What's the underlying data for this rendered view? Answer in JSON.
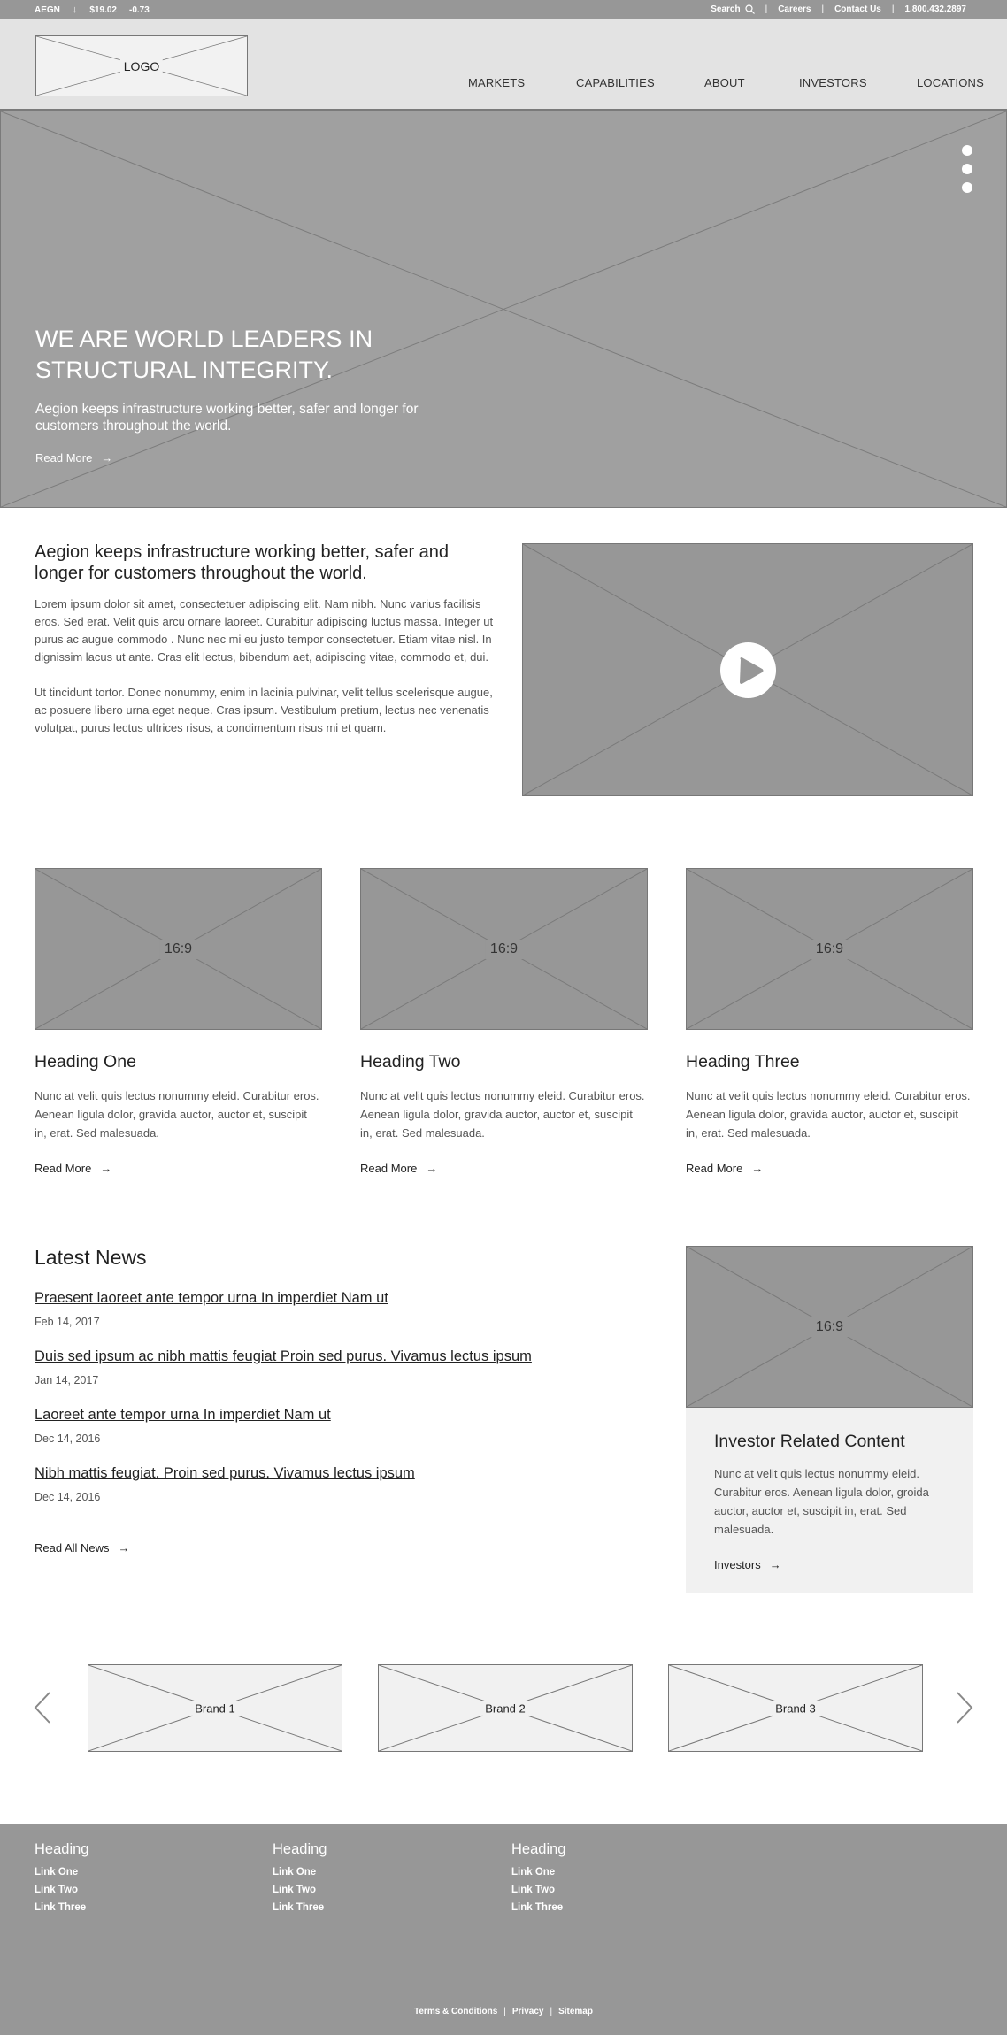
{
  "utility_bar": {
    "ticker": "AEGN",
    "direction_icon": "arrow-down-icon",
    "price": "$19.02",
    "change": "-0.73",
    "search_label": "Search",
    "careers": "Careers",
    "contact": "Contact Us",
    "phone": "1.800.432.2897"
  },
  "header": {
    "logo_label": "LOGO",
    "nav": [
      "MARKETS",
      "CAPABILITIES",
      "ABOUT",
      "INVESTORS",
      "LOCATIONS"
    ]
  },
  "hero": {
    "title": "WE ARE WORLD LEADERS IN STRUCTURAL INTEGRITY.",
    "subtitle": "Aegion keeps infrastructure working better, safer and longer for customers throughout the world.",
    "link": "Read More",
    "slide_count": 3
  },
  "intro": {
    "heading": "Aegion keeps infrastructure working better, safer and longer for customers throughout the world.",
    "paragraphs": [
      "Lorem ipsum dolor sit amet, consectetuer adipiscing elit. Nam nibh. Nunc varius facilisis eros. Sed erat. Velit quis arcu ornare laoreet. Curabitur adipiscing luctus massa. Integer ut purus ac augue commodo . Nunc nec mi eu justo tempor consectetuer. Etiam vitae nisl. In dignissim lacus ut ante. Cras elit lectus, bibendum aet, adipiscing vitae, commodo et, dui.",
      "Ut tincidunt tortor. Donec nonummy, enim in lacinia pulvinar, velit tellus scelerisque augue, ac posuere libero urna eget neque. Cras ipsum. Vestibulum pretium, lectus nec venenatis volutpat, purus lectus ultrices risus, a condimentum risus mi et quam."
    ],
    "video_icon": "play-icon"
  },
  "cards": [
    {
      "image_label": "16:9",
      "heading": "Heading One",
      "body": "Nunc at velit quis lectus nonummy eleid. Curabitur eros. Aenean ligula dolor, gravida auctor, auctor et, suscipit in, erat. Sed malesuada.",
      "link": "Read More"
    },
    {
      "image_label": "16:9",
      "heading": "Heading Two",
      "body": "Nunc at velit quis lectus nonummy eleid. Curabitur eros. Aenean ligula dolor, gravida auctor, auctor et, suscipit in, erat. Sed malesuada.",
      "link": "Read More"
    },
    {
      "image_label": "16:9",
      "heading": "Heading Three",
      "body": "Nunc at velit quis lectus nonummy eleid. Curabitur eros. Aenean ligula dolor, gravida auctor, auctor et, suscipit in, erat. Sed malesuada.",
      "link": "Read More"
    }
  ],
  "news": {
    "title": "Latest News",
    "items": [
      {
        "headline": "Praesent laoreet ante tempor urna In imperdiet Nam ut",
        "date": "Feb 14, 2017"
      },
      {
        "headline": "Duis sed ipsum ac nibh mattis feugiat Proin sed purus. Vivamus lectus ipsum",
        "date": "Jan 14, 2017"
      },
      {
        "headline": "Laoreet ante tempor urna In imperdiet Nam ut",
        "date": "Dec 14, 2016"
      },
      {
        "headline": "Nibh mattis feugiat. Proin sed purus. Vivamus lectus ipsum",
        "date": "Dec 14, 2016"
      }
    ],
    "all_link": "Read All News"
  },
  "investor": {
    "image_label": "16:9",
    "heading": "Investor Related Content",
    "body": "Nunc at velit quis lectus nonummy eleid. Curabitur eros. Aenean ligula dolor, groida auctor, auctor et, suscipit in, erat. Sed malesuada.",
    "link": "Investors"
  },
  "brands": {
    "items": [
      "Brand 1",
      "Brand 2",
      "Brand 3"
    ],
    "prev_icon": "chevron-left-icon",
    "next_icon": "chevron-right-icon"
  },
  "footer": {
    "columns": [
      {
        "heading": "Heading",
        "links": [
          "Link One",
          "Link Two",
          "Link Three"
        ]
      },
      {
        "heading": "Heading",
        "links": [
          "Link One",
          "Link Two",
          "Link Three"
        ]
      },
      {
        "heading": "Heading",
        "links": [
          "Link One",
          "Link Two",
          "Link Three"
        ]
      }
    ],
    "legal": [
      "Terms & Conditions",
      "Privacy",
      "Sitemap"
    ]
  },
  "colors": {
    "placeholder_dark": "#979797",
    "placeholder_light": "#f1f1f1",
    "header_bg": "#e3e3e3",
    "hero_bg": "#a0a0a0",
    "text_dark": "#222222",
    "text_muted": "#555555"
  }
}
